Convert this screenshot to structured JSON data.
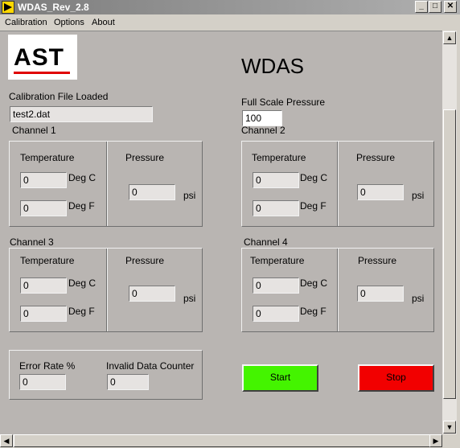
{
  "window": {
    "title": "WDAS_Rev_2.8"
  },
  "menu": {
    "items": [
      "Calibration",
      "Options",
      "About"
    ]
  },
  "logo": {
    "text": "AST"
  },
  "app_title": "WDAS",
  "calibration": {
    "label": "Calibration File Loaded",
    "value": "test2.dat"
  },
  "full_scale": {
    "label": "Full Scale Pressure",
    "value": "100"
  },
  "channels": [
    {
      "title": "Channel 1",
      "temp_label": "Temperature",
      "pressure_label": "Pressure",
      "deg_c": "0",
      "deg_f": "0",
      "pressure": "0",
      "unit_c": "Deg C",
      "unit_f": "Deg F",
      "unit_p": "psi"
    },
    {
      "title": "Channel 2",
      "temp_label": "Temperature",
      "pressure_label": "Pressure",
      "deg_c": "0",
      "deg_f": "0",
      "pressure": "0",
      "unit_c": "Deg C",
      "unit_f": "Deg F",
      "unit_p": "psi"
    },
    {
      "title": "Channel 3",
      "temp_label": "Temperature",
      "pressure_label": "Pressure",
      "deg_c": "0",
      "deg_f": "0",
      "pressure": "0",
      "unit_c": "Deg C",
      "unit_f": "Deg F",
      "unit_p": "psi"
    },
    {
      "title": "Channel 4",
      "temp_label": "Temperature",
      "pressure_label": "Pressure",
      "deg_c": "0",
      "deg_f": "0",
      "pressure": "0",
      "unit_c": "Deg C",
      "unit_f": "Deg F",
      "unit_p": "psi"
    }
  ],
  "stats": {
    "error_label": "Error Rate %",
    "error_value": "0",
    "invalid_label": "Invalid Data Counter",
    "invalid_value": "0"
  },
  "buttons": {
    "start": "Start",
    "stop": "Stop"
  },
  "colors": {
    "start": "#44f400",
    "stop": "#f20000",
    "panel": "#b9b5b2"
  }
}
